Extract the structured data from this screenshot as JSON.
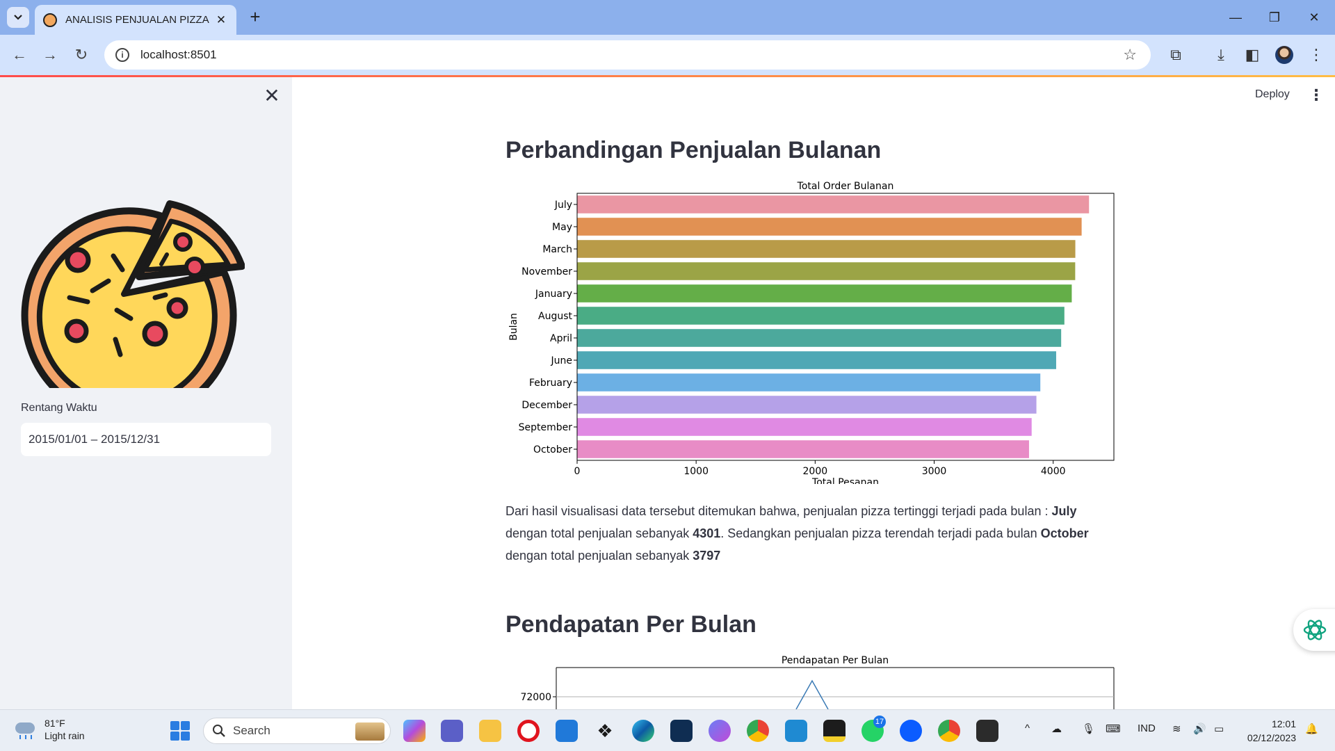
{
  "browser": {
    "tab_title": "ANALISIS PENJUALAN PIZZA",
    "url": "localhost:8501"
  },
  "header": {
    "deploy_label": "Deploy"
  },
  "sidebar": {
    "date_label": "Rentang Waktu",
    "date_value": "2015/01/01 – 2015/12/31"
  },
  "section1": {
    "title": "Perbandingan Penjualan Bulanan",
    "paragraph": {
      "t1": "Dari hasil visualisasi data tersebut ditemukan bahwa, penjualan pizza tertinggi terjadi pada bulan : ",
      "b1": "July",
      "t2": " dengan total penjualan sebanyak ",
      "b2": "4301",
      "t3": ". Sedangkan penjualan pizza terendah terjadi pada bulan ",
      "b3": "October",
      "t4": " dengan total penjualan sebanyak ",
      "b4": "3797"
    }
  },
  "section2": {
    "title": "Pendapatan Per Bulan"
  },
  "chart_data": [
    {
      "type": "bar",
      "orientation": "horizontal",
      "title": "Total Order Bulanan",
      "xlabel": "Total Pesanan",
      "ylabel": "Bulan",
      "xlim": [
        0,
        4510
      ],
      "xticks": [
        "0",
        "1000",
        "2000",
        "3000",
        "4000"
      ],
      "categories": [
        "July",
        "May",
        "March",
        "November",
        "January",
        "August",
        "April",
        "June",
        "February",
        "December",
        "September",
        "October"
      ],
      "values": [
        4301,
        4239,
        4186,
        4185,
        4156,
        4094,
        4067,
        4025,
        3892,
        3859,
        3819,
        3797
      ],
      "colors": [
        "#ea96a3",
        "#e19153",
        "#b99b48",
        "#9ba446",
        "#64ae48",
        "#4aac85",
        "#4ca99c",
        "#4fa8b5",
        "#6cb0e4",
        "#b5a1e8",
        "#e08ae3",
        "#e88cc6"
      ]
    },
    {
      "type": "line",
      "title": "Pendapatan Per Bulan",
      "yticks": [
        "72000"
      ],
      "ylim_top": 73500,
      "visible_partial": true
    }
  ],
  "taskbar": {
    "weather_temp": "81°F",
    "weather_desc": "Light rain",
    "search_placeholder": "Search",
    "lang": "IND",
    "time": "12:01",
    "date": "02/12/2023",
    "whatsapp_badge": "17"
  }
}
